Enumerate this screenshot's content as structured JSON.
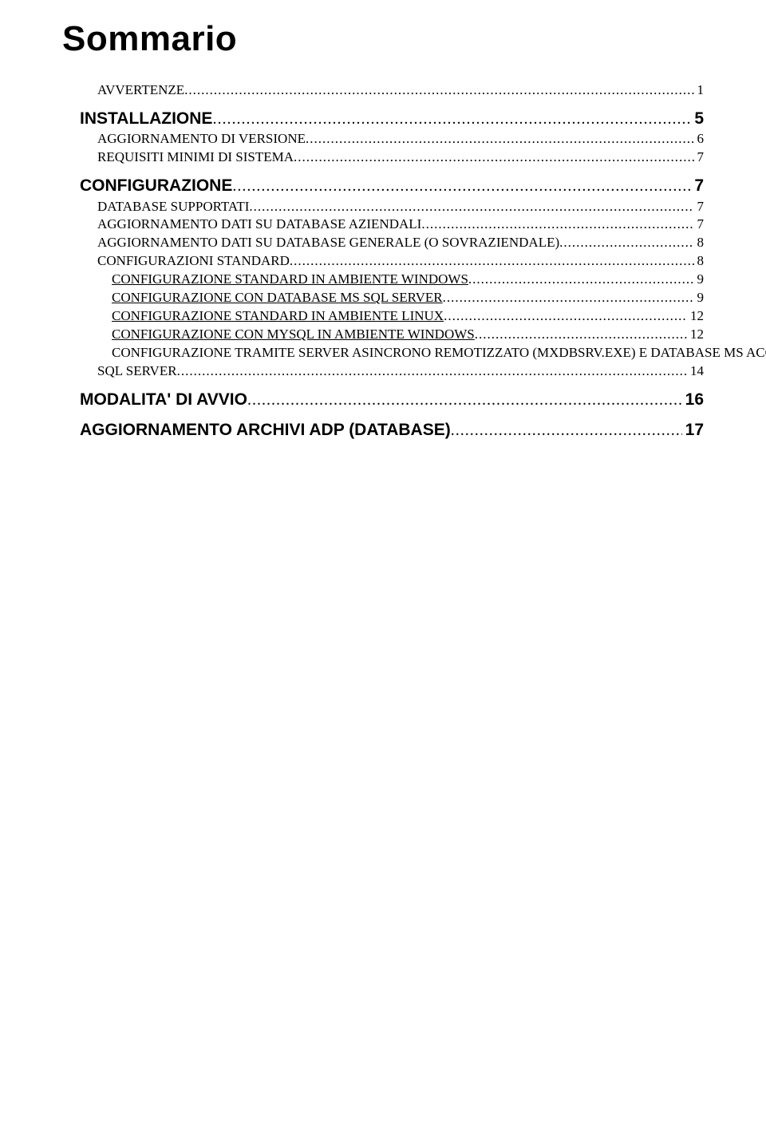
{
  "title": "Sommario",
  "toc": [
    {
      "kind": "item",
      "label": "AVVERTENZE",
      "page": "1",
      "cls": "serif",
      "indent": "lvl-item"
    },
    {
      "kind": "gap",
      "size": "md"
    },
    {
      "kind": "section",
      "label": "INSTALLAZIONE",
      "page": "5",
      "cls": "sans bold sec-title",
      "indent": "lvl-sec"
    },
    {
      "kind": "item",
      "label": "AGGIORNAMENTO DI VERSIONE",
      "page": "6",
      "cls": "serif",
      "indent": "lvl-item"
    },
    {
      "kind": "item",
      "label": "REQUISITI MINIMI DI SISTEMA",
      "page": "7",
      "cls": "serif",
      "indent": "lvl-item"
    },
    {
      "kind": "gap",
      "size": "md"
    },
    {
      "kind": "section",
      "label": "CONFIGURAZIONE",
      "page": "7",
      "cls": "sans bold sec-title",
      "indent": "lvl-sec"
    },
    {
      "kind": "item",
      "label": "DATABASE SUPPORTATI",
      "page": "7",
      "cls": "serif",
      "indent": "lvl-item"
    },
    {
      "kind": "item",
      "label": "AGGIORNAMENTO DATI SU DATABASE AZIENDALI",
      "page": "7",
      "cls": "serif",
      "indent": "lvl-item"
    },
    {
      "kind": "item",
      "label": "AGGIORNAMENTO DATI SU DATABASE GENERALE (O SOVRAZIENDALE)",
      "page": "8",
      "cls": "serif",
      "indent": "lvl-item"
    },
    {
      "kind": "item",
      "label": "CONFIGURAZIONI STANDARD",
      "page": "8",
      "cls": "serif",
      "indent": "lvl-item"
    },
    {
      "kind": "sub",
      "label": "CONFIGURAZIONE STANDARD IN AMBIENTE WINDOWS",
      "page": "9",
      "cls": "serif under",
      "indent": "lvl-sub"
    },
    {
      "kind": "sub",
      "label": "CONFIGURAZIONE CON DATABASE MS SQL SERVER",
      "page": "9",
      "cls": "serif under",
      "indent": "lvl-sub"
    },
    {
      "kind": "sub",
      "label": "CONFIGURAZIONE STANDARD IN AMBIENTE LINUX",
      "page": "12",
      "cls": "serif under",
      "indent": "lvl-sub"
    },
    {
      "kind": "sub",
      "label": "CONFIGURAZIONE CON MYSQL IN AMBIENTE WINDOWS",
      "page": "12",
      "cls": "serif under",
      "indent": "lvl-sub"
    },
    {
      "kind": "wrap",
      "label1": "CONFIGURAZIONE TRAMITE SERVER ASINCRONO REMOTIZZATO (MXDBSRV.EXE) E DATABASE MS ACCESS O",
      "label2": "SQL SERVER",
      "page": "14",
      "cls": "serif",
      "indent": "lvl-sub",
      "indent2": "lvl-item",
      "page1": "14"
    },
    {
      "kind": "gap",
      "size": "md"
    },
    {
      "kind": "section",
      "label": "MODALITA' DI AVVIO",
      "page": "16",
      "cls": "sans bold sec-title",
      "indent": "lvl-sec"
    },
    {
      "kind": "gap",
      "size": "md"
    },
    {
      "kind": "section",
      "label": "AGGIORNAMENTO ARCHIVI ADP (DATABASE)",
      "page": "17",
      "cls": "sans bold sec-title",
      "indent": "lvl-sec"
    }
  ]
}
